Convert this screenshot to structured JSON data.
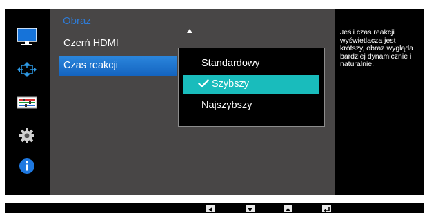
{
  "menu": {
    "title": "Obraz",
    "items": [
      {
        "label": "Czerń HDMI",
        "selected": false
      },
      {
        "label": "Czas reakcji",
        "selected": true
      }
    ]
  },
  "dropdown": {
    "options": [
      {
        "label": "Standardowy",
        "selected": false
      },
      {
        "label": "Szybszy",
        "selected": true
      },
      {
        "label": "Najszybszy",
        "selected": false
      }
    ]
  },
  "help": {
    "text": "Jeśli czas reakcji wyświetlacza jest krótszy, obraz wygląda bardziej dynamicznie i naturalnie."
  },
  "sidebar": {
    "icons": [
      "picture-icon",
      "screen-size-icon",
      "settings-adjust-icon",
      "gear-icon",
      "info-icon"
    ]
  },
  "bottom_bar": {
    "keys": [
      "left-arrow-key",
      "down-arrow-key",
      "up-arrow-key",
      "enter-key"
    ]
  },
  "colors": {
    "accent_blue": "#2e7bd6",
    "selected_item": "#1a70cc",
    "selected_option": "#19bcbc",
    "panel_bg": "#484646"
  }
}
